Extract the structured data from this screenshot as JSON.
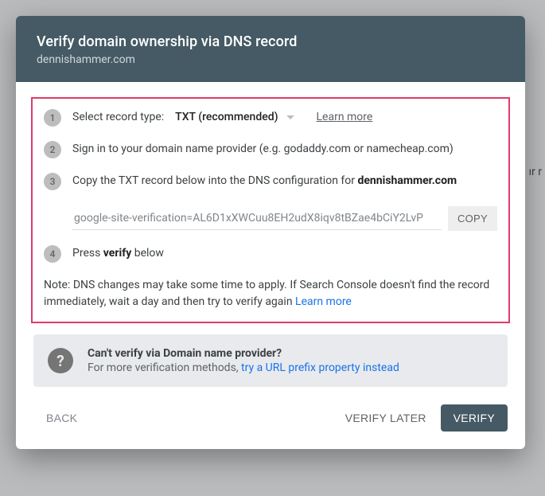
{
  "background": {
    "snippet": "ır r"
  },
  "header": {
    "title": "Verify domain ownership via DNS record",
    "subtitle": "dennishammer.com"
  },
  "steps": {
    "s1": {
      "num": "1",
      "label": "Select record type:",
      "record_type": "TXT (recommended)",
      "learn_more": "Learn more"
    },
    "s2": {
      "num": "2",
      "text": "Sign in to your domain name provider (e.g. godaddy.com or namecheap.com)"
    },
    "s3": {
      "num": "3",
      "prefix": "Copy the TXT record below into the DNS configuration for ",
      "domain": "dennishammer.com",
      "txt_value": "google-site-verification=AL6D1xXWCuu8EH2udX8iqv8tBZae4bCiY2LvP",
      "copy_label": "COPY"
    },
    "s4": {
      "num": "4",
      "prefix": "Press ",
      "bold": "verify",
      "suffix": " below"
    }
  },
  "note": {
    "text": "Note: DNS changes may take some time to apply. If Search Console doesn't find the record immediately, wait a day and then try to verify again ",
    "link": "Learn more"
  },
  "alt": {
    "icon": "?",
    "title": "Can't verify via Domain name provider?",
    "sub_prefix": "For more verification methods, ",
    "sub_link": "try a URL prefix property instead"
  },
  "footer": {
    "back": "BACK",
    "verify_later": "VERIFY LATER",
    "verify": "VERIFY"
  }
}
